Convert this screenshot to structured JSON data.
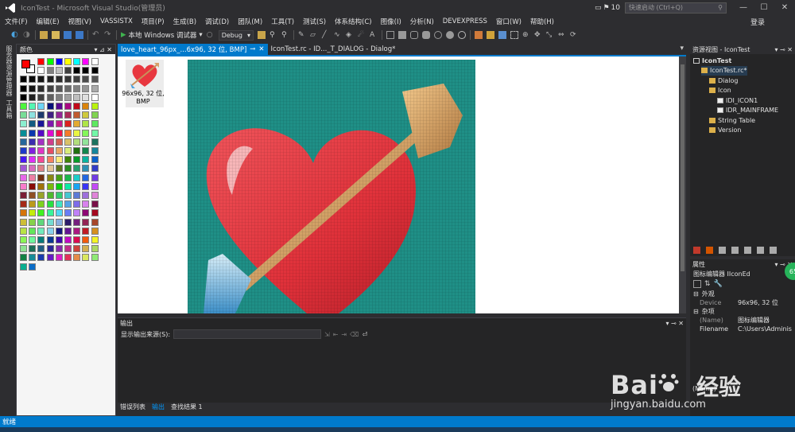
{
  "window": {
    "title": "IconTest - Microsoft Visual Studio(管理员)",
    "notifications": "10",
    "quick_launch_placeholder": "快速启动 (Ctrl+Q)",
    "login": "登录"
  },
  "menu": [
    "文件(F)",
    "编辑(E)",
    "视图(V)",
    "VASSISTX",
    "项目(P)",
    "生成(B)",
    "调试(D)",
    "团队(M)",
    "工具(T)",
    "测试(S)",
    "体系结构(C)",
    "图像(I)",
    "分析(N)",
    "DEVEXPRESS",
    "窗口(W)",
    "帮助(H)"
  ],
  "toolbar": {
    "run_label": "本地 Windows 调试器",
    "config": "Debug"
  },
  "left_strip": {
    "tabs": [
      "服务器资源管理器",
      "工具箱"
    ]
  },
  "palette": {
    "title": "颜色"
  },
  "doc_tabs": [
    {
      "label": "love_heart_96px_...6x96, 32 位, BMP]",
      "active": true
    },
    {
      "label": "IconTest.rc - ID..._T_DIALOG - Dialog*",
      "active": false
    }
  ],
  "editor": {
    "thumb_label": "96x96, 32 位, BMP"
  },
  "output": {
    "title": "输出",
    "source_label": "显示输出来源(S):",
    "tabs": [
      {
        "label": "错误列表",
        "active": false
      },
      {
        "label": "输出",
        "active": true
      },
      {
        "label": "查找结果 1",
        "active": false
      }
    ]
  },
  "resview": {
    "title": "资源视图 - IconTest",
    "tree": [
      {
        "label": "IconTest",
        "indent": 0,
        "bold": true,
        "icon": "project-icon"
      },
      {
        "label": "IconTest.rc*",
        "indent": 1,
        "bold": false,
        "icon": "rc-folder-icon",
        "selected": true
      },
      {
        "label": "Dialog",
        "indent": 2,
        "bold": false,
        "icon": "folder-icon"
      },
      {
        "label": "Icon",
        "indent": 2,
        "bold": false,
        "icon": "folder-icon"
      },
      {
        "label": "IDI_ICON1",
        "indent": 3,
        "bold": false,
        "icon": "file-icon"
      },
      {
        "label": "IDR_MAINFRAME",
        "indent": 3,
        "bold": false,
        "icon": "file-icon"
      },
      {
        "label": "String Table",
        "indent": 2,
        "bold": false,
        "icon": "folder-icon"
      },
      {
        "label": "Version",
        "indent": 2,
        "bold": false,
        "icon": "folder-icon"
      }
    ]
  },
  "properties": {
    "title": "属性",
    "object": "图标编辑器 IIconEd",
    "cat_appearance": "外观",
    "device_name": "Device",
    "device_value": "96x96, 32 位",
    "cat_misc": "杂项",
    "name_name": "(Name)",
    "name_value": "图标编辑器",
    "filename_name": "Filename",
    "filename_value": "C:\\Users\\Adminis",
    "desc": "(Name)"
  },
  "status": {
    "text": "就绪"
  },
  "badge": "65",
  "watermark": {
    "brand": "Bai",
    "brand2": "经验",
    "url": "jingyan.baidu.com"
  },
  "colors": {
    "accent": "#007acc",
    "canvas_bg": "#1f8f86",
    "heart": "#e8373f"
  }
}
